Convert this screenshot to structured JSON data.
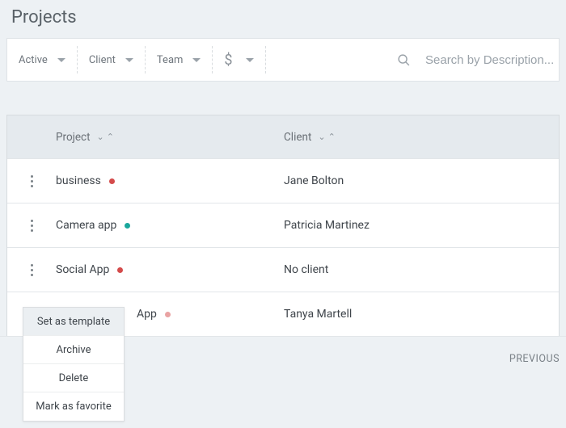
{
  "title": "Projects",
  "filters": {
    "status": "Active",
    "client": "Client",
    "team": "Team",
    "currency_symbol": "$"
  },
  "search": {
    "placeholder": "Search by Description..."
  },
  "table": {
    "headers": {
      "project": "Project",
      "client": "Client"
    },
    "rows": [
      {
        "project": "business",
        "dot": "#d44b4b",
        "client": "Jane Bolton"
      },
      {
        "project": "Camera app",
        "dot": "#1aa79c",
        "client": "Patricia Martinez"
      },
      {
        "project": "Social App",
        "dot": "#d44b4b",
        "client": "No client"
      },
      {
        "project": "App",
        "dot": "#e9a3a3",
        "client": "Tanya Martell"
      }
    ]
  },
  "context_menu": {
    "set_template": "Set as template",
    "archive": "Archive",
    "delete": "Delete",
    "favorite": "Mark as favorite"
  },
  "footer": {
    "previous": "PREVIOUS"
  }
}
